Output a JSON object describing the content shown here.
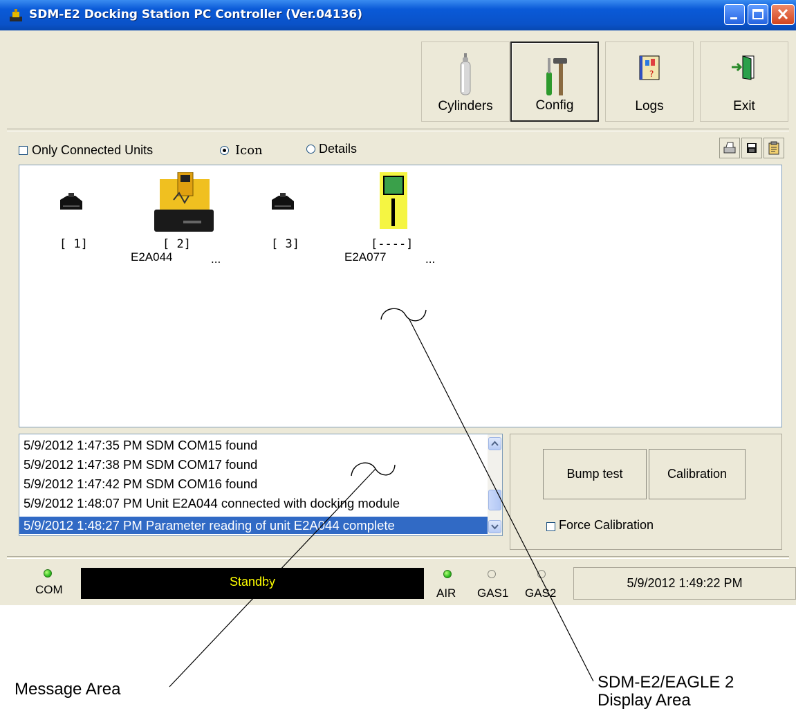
{
  "window": {
    "title": "SDM-E2 Docking Station PC Controller (Ver.04136)"
  },
  "toolbar": {
    "cylinders_label": "Cylinders",
    "config_label": "Config",
    "logs_label": "Logs",
    "exit_label": "Exit"
  },
  "options": {
    "only_connected_label": "Only Connected Units",
    "only_connected_checked": false,
    "icon_label": "Icon",
    "details_label": "Details",
    "view_mode": "Icon"
  },
  "units": [
    {
      "label": "[ 1]",
      "serial": "",
      "dots": "",
      "icon": "docking-module-icon"
    },
    {
      "label": "[ 2]",
      "serial": "E2A044",
      "dots": "...",
      "icon": "docking-station-with-unit-icon"
    },
    {
      "label": "[ 3]",
      "serial": "",
      "dots": "",
      "icon": "docking-module-icon"
    },
    {
      "label": "[----]",
      "serial": "E2A077",
      "dots": "...",
      "icon": "eagle2-instrument-icon"
    }
  ],
  "messages": [
    "5/9/2012 1:47:35 PM SDM COM15 found",
    "5/9/2012 1:47:38 PM SDM COM17 found",
    "5/9/2012 1:47:42 PM SDM COM16 found",
    "5/9/2012 1:48:07 PM Unit E2A044 connected with docking module",
    "5/9/2012 1:48:27 PM Parameter reading of unit E2A044 complete"
  ],
  "selected_message_index": 4,
  "test_panel": {
    "bump_label": "Bump test",
    "calibration_label": "Calibration",
    "force_calibration_label": "Force Calibration",
    "force_calibration_checked": false
  },
  "status": {
    "com_label": "COM",
    "com_state": "on",
    "status_text": "Standby",
    "air_label": "AIR",
    "air_state": "on",
    "gas1_label": "GAS1",
    "gas1_state": "off",
    "gas2_label": "GAS2",
    "gas2_state": "off",
    "datetime": "5/9/2012 1:49:22 PM"
  },
  "annotations": {
    "message_area": "Message Area",
    "display_area_line1": "SDM-E2/EAGLE 2",
    "display_area_line2": "Display Area"
  },
  "colors": {
    "titlebar": "#0a5ad8",
    "window_bg": "#ece9d8",
    "selection": "#316ac5",
    "status_text": "#ffff00",
    "led_on": "#2fbf20"
  }
}
